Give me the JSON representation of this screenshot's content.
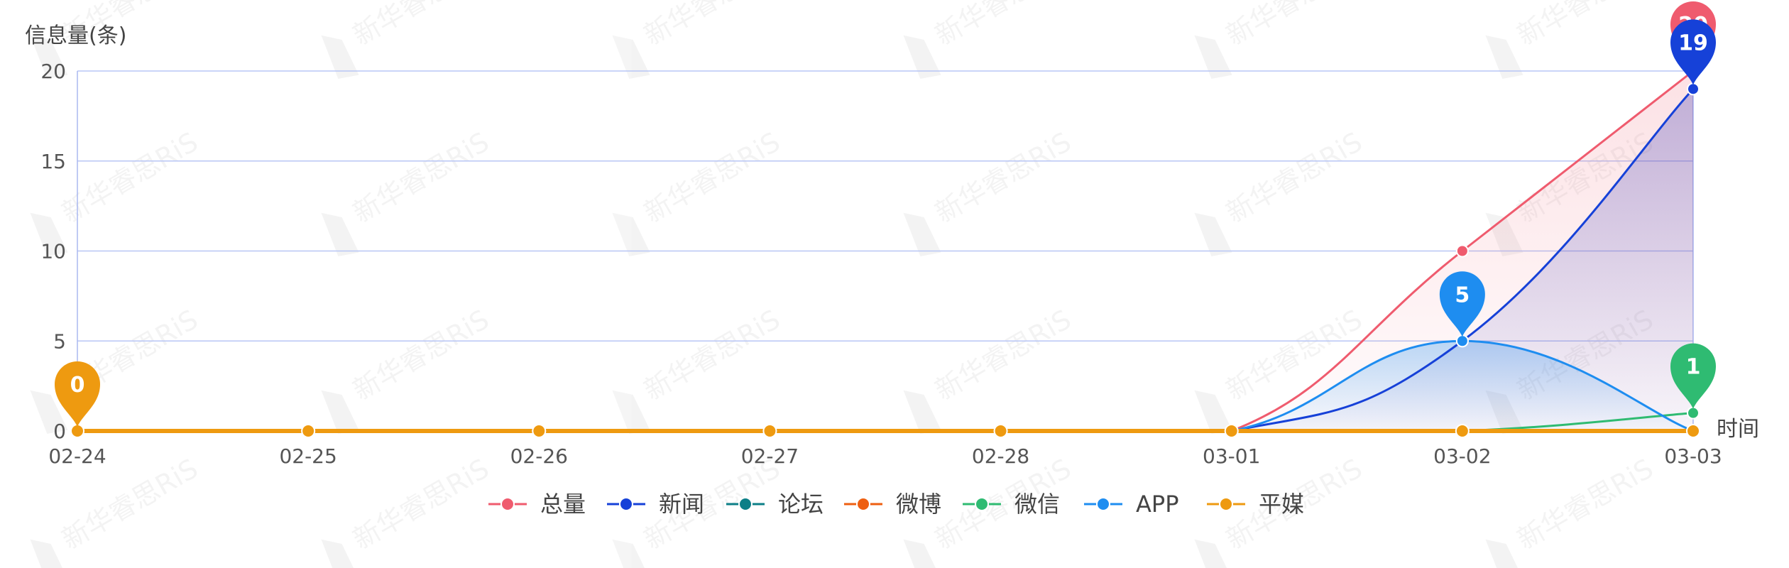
{
  "chart_data": {
    "type": "line",
    "ylabel": "信息量(条)",
    "xlabel": "时间",
    "categories": [
      "02-24",
      "02-25",
      "02-26",
      "02-27",
      "02-28",
      "03-01",
      "03-02",
      "03-03"
    ],
    "ylim": [
      0,
      20
    ],
    "yticks": [
      0,
      5,
      10,
      15,
      20
    ],
    "grid": true,
    "legend_position": "bottom",
    "series": [
      {
        "name": "总量",
        "color": "#ef5b6e",
        "values": [
          0,
          0,
          0,
          0,
          0,
          0,
          10,
          20
        ],
        "area": true
      },
      {
        "name": "新闻",
        "color": "#1641d8",
        "values": [
          0,
          0,
          0,
          0,
          0,
          0,
          5,
          19
        ],
        "area": true
      },
      {
        "name": "论坛",
        "color": "#0c7f87",
        "values": [
          0,
          0,
          0,
          0,
          0,
          0,
          0,
          0
        ]
      },
      {
        "name": "微博",
        "color": "#ee5f11",
        "values": [
          0,
          0,
          0,
          0,
          0,
          0,
          0,
          0
        ]
      },
      {
        "name": "微信",
        "color": "#2fbb72",
        "values": [
          0,
          0,
          0,
          0,
          0,
          0,
          0,
          1
        ]
      },
      {
        "name": "APP",
        "color": "#1e8df0",
        "values": [
          0,
          0,
          0,
          0,
          0,
          0,
          5,
          0
        ],
        "area": true
      },
      {
        "name": "平媒",
        "color": "#ee9a10",
        "values": [
          0,
          0,
          0,
          0,
          0,
          0,
          0,
          0
        ]
      }
    ],
    "markers": [
      {
        "series": "总量",
        "category": "03-03",
        "label": "20",
        "color": "#ef5b6e"
      },
      {
        "series": "新闻",
        "category": "03-03",
        "label": "19",
        "color": "#1641d8"
      },
      {
        "series": "APP",
        "category": "03-02",
        "label": "5",
        "color": "#1e8df0"
      },
      {
        "series": "微信",
        "category": "03-03",
        "label": "1",
        "color": "#2fbb72"
      },
      {
        "series": "平媒",
        "category": "02-24",
        "label": "0",
        "color": "#ee9a10"
      }
    ],
    "watermark": "新华睿思RiS"
  }
}
